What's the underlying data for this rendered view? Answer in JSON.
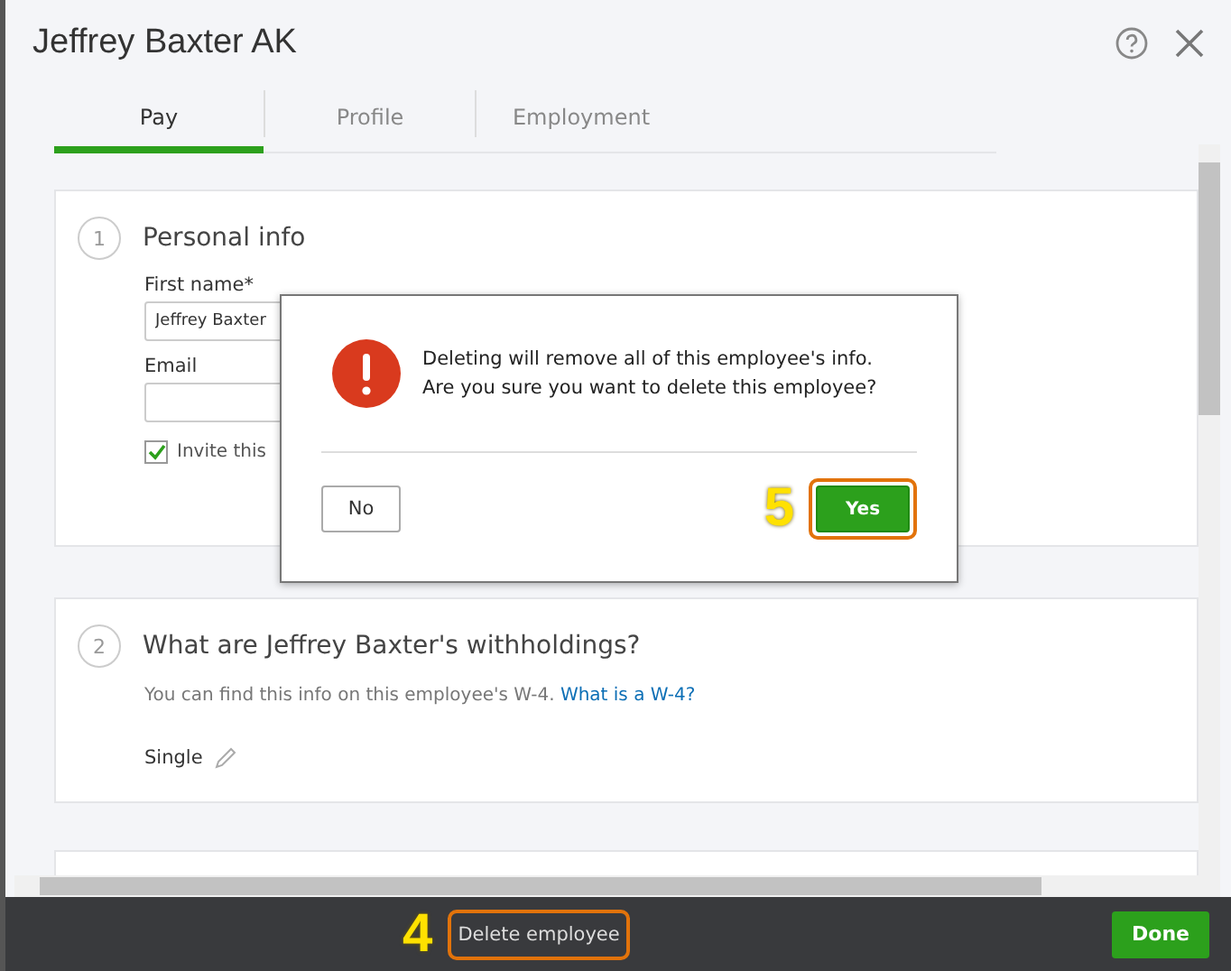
{
  "window": {
    "title": "Jeffrey Baxter AK"
  },
  "tabs": [
    {
      "label": "Pay",
      "selected": true
    },
    {
      "label": "Profile",
      "selected": false
    },
    {
      "label": "Employment",
      "selected": false
    }
  ],
  "personal_info": {
    "step": "1",
    "heading": "Personal info",
    "first_name": {
      "label": "First name*",
      "value": "Jeffrey Baxter"
    },
    "email": {
      "label": "Email"
    },
    "invite": {
      "label": "Invite this",
      "checked": true
    }
  },
  "withholdings": {
    "step": "2",
    "heading": "What are Jeffrey Baxter's withholdings?",
    "note": "You can find this info on this employee's W-4.",
    "link": "What is a W-4?",
    "filing_status": "Single"
  },
  "dialog": {
    "message": [
      "Deleting will remove all of this employee's info.",
      "Are you sure you want to delete this employee?"
    ],
    "buttons": [
      {
        "label": "No",
        "kind": "secondary"
      },
      {
        "label": "Yes",
        "kind": "primary"
      }
    ]
  },
  "callouts": [
    {
      "label": "4"
    },
    {
      "label": "5"
    }
  ],
  "footer": {
    "delete": "Delete employee",
    "done": "Done"
  }
}
